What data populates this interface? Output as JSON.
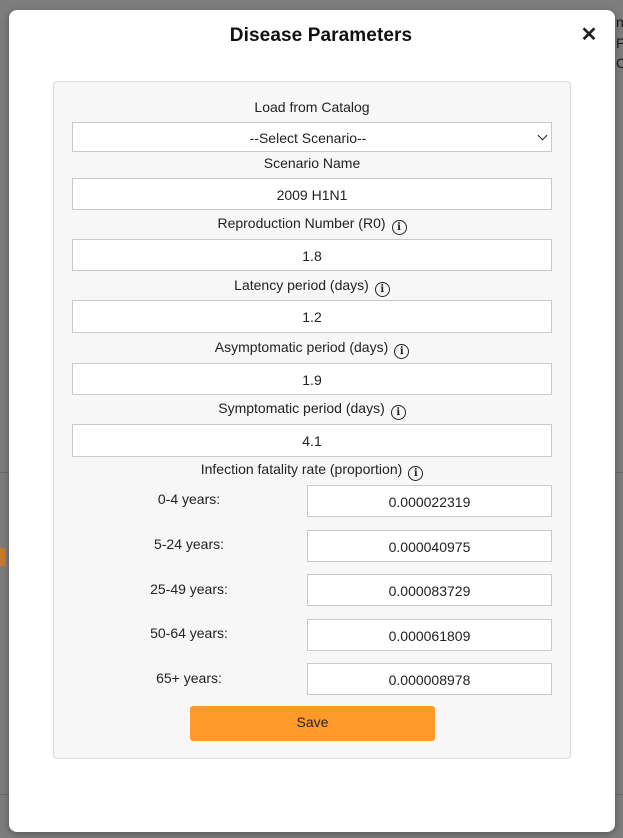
{
  "background": {
    "right_edge_text": [
      "na",
      "P",
      "C"
    ]
  },
  "modal": {
    "title": "Disease Parameters",
    "close_symbol": "✕"
  },
  "catalog": {
    "label": "Load from Catalog",
    "selected": "--Select Scenario--"
  },
  "scenario": {
    "label": "Scenario Name",
    "value": "2009 H1N1"
  },
  "r0": {
    "label": "Reproduction Number (R0)",
    "value": "1.8"
  },
  "latency": {
    "label": "Latency period (days)",
    "value": "1.2"
  },
  "asymptomatic": {
    "label": "Asymptomatic period (days)",
    "value": "1.9"
  },
  "symptomatic": {
    "label": "Symptomatic period (days)",
    "value": "4.1"
  },
  "ifr": {
    "label": "Infection fatality rate (proportion)",
    "groups": [
      {
        "label": "0-4 years:",
        "value": "0.000022319"
      },
      {
        "label": "5-24 years:",
        "value": "0.000040975"
      },
      {
        "label": "25-49 years:",
        "value": "0.000083729"
      },
      {
        "label": "50-64 years:",
        "value": "0.000061809"
      },
      {
        "label": "65+ years:",
        "value": "0.000008978"
      }
    ]
  },
  "info_glyph": "i",
  "save_label": "Save",
  "colors": {
    "save_button": "#ff9a2a",
    "overlay": "#8a8a8a"
  }
}
